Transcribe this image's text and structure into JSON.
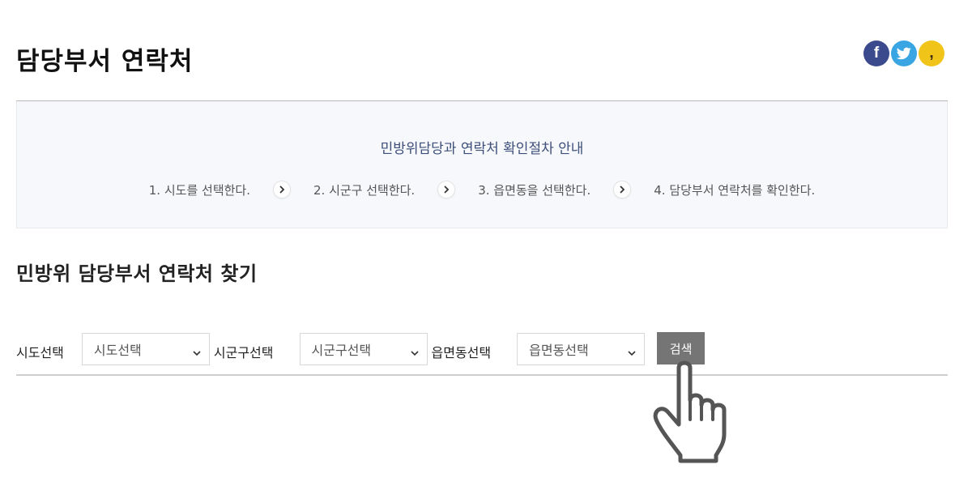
{
  "header": {
    "title": "담당부서 연락처",
    "social": [
      {
        "name": "facebook-icon",
        "glyph": "f",
        "color": "#3b4a8c"
      },
      {
        "name": "twitter-icon",
        "glyph": "bird",
        "color": "#3aa5e3"
      },
      {
        "name": "kakaostory-icon",
        "glyph": ",",
        "color": "#f0c419"
      }
    ]
  },
  "guide": {
    "title": "민방위담당과 연락처 확인절차 안내",
    "steps": [
      "1. 시도를 선택한다.",
      "2. 시군구 선택한다.",
      "3. 읍면동을 선택한다.",
      "4. 담당부서 연락처를 확인한다."
    ]
  },
  "search": {
    "section_title": "민방위 담당부서 연락처 찾기",
    "sido_label": "시도선택",
    "sido_value": "시도선택",
    "sigungu_label": "시군구선택",
    "sigungu_value": "시군구선택",
    "eupmyeondong_label": "읍면동선택",
    "eupmyeondong_value": "읍면동선택",
    "button_label": "검색"
  },
  "colors": {
    "guide_bg": "#f6f8fb",
    "guide_title": "#3d4f7a",
    "button_bg": "#757575"
  }
}
